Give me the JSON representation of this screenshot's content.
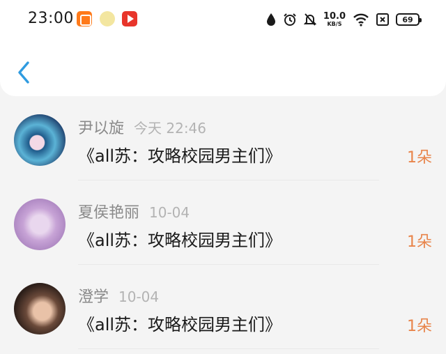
{
  "status_bar": {
    "time": "23:00",
    "apps": [
      "orange-app-icon",
      "yellow-app-icon",
      "video-app-icon"
    ],
    "net_speed_value": "10.0",
    "net_speed_unit": "KB/S",
    "battery": "69"
  },
  "header": {
    "back_icon": "chevron-left-icon",
    "accent": "#2f9be0"
  },
  "items": [
    {
      "name": "尹以旋",
      "time": "今天 22:46",
      "title": "《all苏：攻略校园男主们》",
      "count": "1朵"
    },
    {
      "name": "夏侯艳丽",
      "time": "10-04",
      "title": "《all苏：攻略校园男主们》",
      "count": "1朵"
    },
    {
      "name": "澄学",
      "time": "10-04",
      "title": "《all苏：攻略校园男主们》",
      "count": "1朵"
    }
  ],
  "colors": {
    "count": "#e8844a",
    "name": "#8a8a8a",
    "time": "#b3b3b3"
  }
}
